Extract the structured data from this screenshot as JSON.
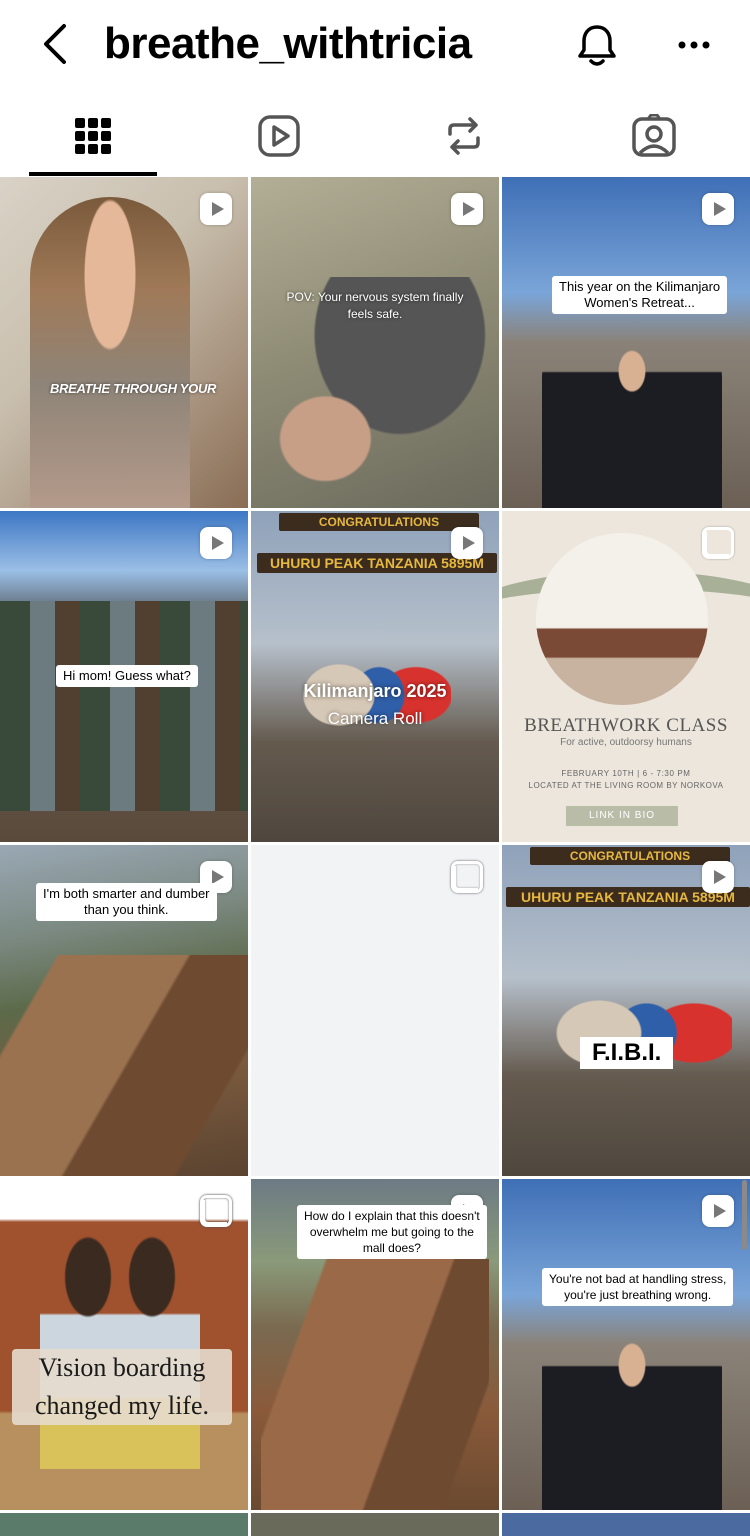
{
  "header": {
    "username": "breathe_withtricia",
    "back_icon": "chevron-left-icon",
    "bell_icon": "bell-icon",
    "more_icon": "ellipsis-icon"
  },
  "tabs": [
    {
      "name": "grid",
      "icon": "grid-icon",
      "active": true
    },
    {
      "name": "reels",
      "icon": "reels-icon",
      "active": false
    },
    {
      "name": "reposts",
      "icon": "repost-icon",
      "active": false
    },
    {
      "name": "tagged",
      "icon": "tagged-icon",
      "active": false
    }
  ],
  "posts": [
    {
      "type": "reel",
      "caption": "BREATHE THROUGH YOUR"
    },
    {
      "type": "reel",
      "caption": "POV: Your nervous system finally\nfeels safe."
    },
    {
      "type": "reel",
      "caption": "This year on the Kilimanjaro\nWomen's Retreat..."
    },
    {
      "type": "reel",
      "caption": "Hi mom! Guess what?"
    },
    {
      "type": "reel",
      "caption": "Kilimanjaro 2025",
      "subcaption": "Camera Roll",
      "sign_top": "CONGRATULATIONS",
      "sign_main": "UHURU PEAK TANZANIA 5895M"
    },
    {
      "type": "carousel",
      "title": "BREATHWORK CLASS",
      "subtitle": "For active, outdoorsy humans",
      "date": "FEBRUARY 10TH  |  6 - 7:30 PM",
      "location": "LOCATED AT THE LIVING ROOM BY NORKOVA",
      "button": "LINK IN BIO"
    },
    {
      "type": "reel",
      "caption": "I'm both smarter and dumber\nthan you think."
    },
    {
      "type": "carousel",
      "caption": ""
    },
    {
      "type": "reel",
      "caption": "F.I.B.I.",
      "sign_top": "CONGRATULATIONS",
      "sign_main": "UHURU PEAK TANZANIA 5895M"
    },
    {
      "type": "carousel",
      "caption": "Vision boarding\nchanged my life."
    },
    {
      "type": "reel",
      "caption": "How do I explain that this doesn't\noverwhelm me but going to the\nmall does?"
    },
    {
      "type": "reel",
      "caption": "You're not bad at handling stress,\nyou're just breathing wrong."
    }
  ],
  "colors": {
    "active_tab": "#000000",
    "icon_gray": "#555555",
    "empty_tile": "#f2f3f5"
  }
}
